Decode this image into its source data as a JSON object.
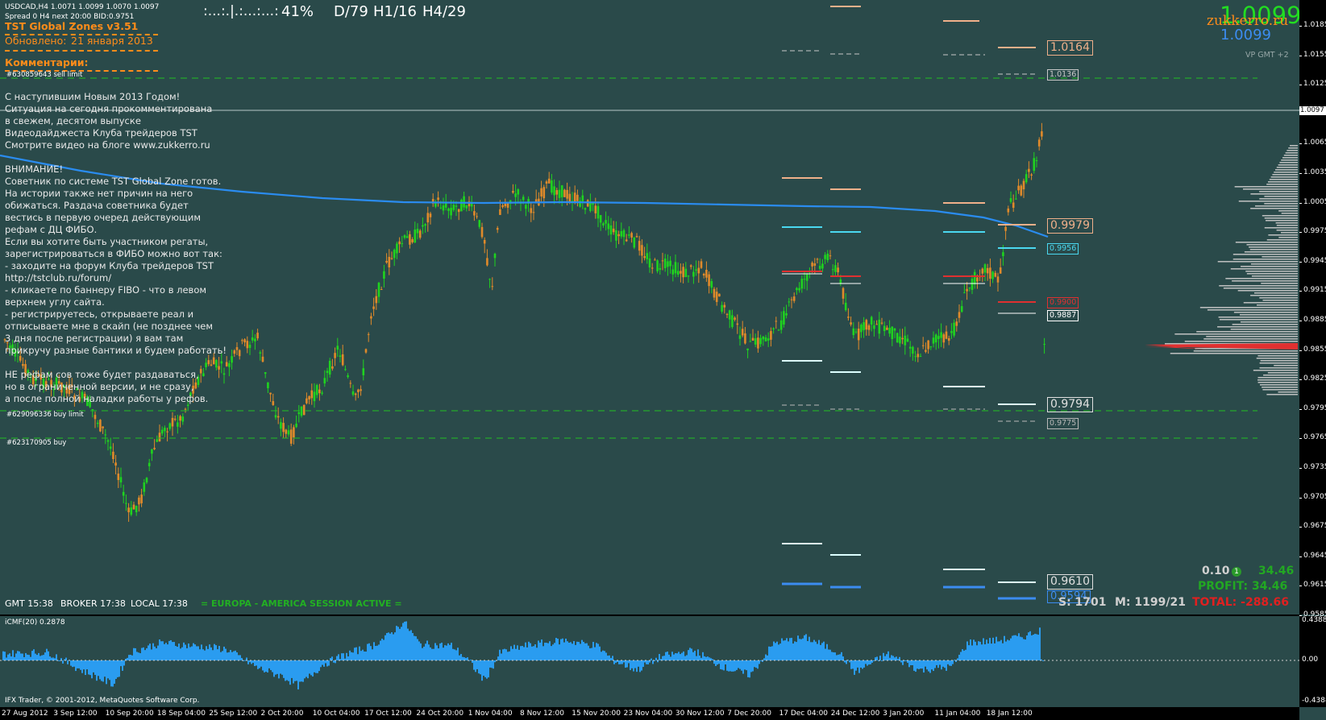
{
  "header": {
    "symbol_line": "USDCAD,H4  1.0071 1.0099 1.0070 1.0097",
    "spread_line": "Spread 0  H4 next 20:00 BID:0.9751",
    "progress_dots": ":...:.|.:...:...:",
    "progress_pct": "41%",
    "d_stat": "D/79",
    "h1_stat": "H1/16",
    "h4_stat": "H4/29"
  },
  "panel": {
    "title": "TST Global Zones  v3.51",
    "updated_label": "Обновлено:",
    "updated_date": "21 января 2013",
    "comments_title": "Комментарии:",
    "order_sell_limit": "#630859643 sell limit",
    "order_buy_limit": "#629096336 buy limit",
    "order_buy": "#623170905 buy",
    "comment_lines": [
      "С наступившим  Новым 2013 Годом!",
      "Ситуация на сегодня прокомментирована",
      " в свежем, десятом  выпуске",
      " Видеодайджеста Клуба трейдеров TST",
      "Смотрите видео на блоге www.zukkerro.ru",
      "",
      "ВНИМАНИЕ!",
      "Советник по системе TST Global Zone готов.",
      "На истории также нет причин на него",
      "обижаться. Раздача советника будет",
      "  вестись в первую очеред действующим",
      "  рефам с ДЦ ФИБО.",
      "Если вы хотите быть участником регаты,",
      "зарегистрироваться в ФИБО можно вот так:",
      "- заходите на форум Клуба трейдеров TST",
      "http://tstclub.ru/forum/",
      "- кликаете по баннеру FIBO  - что в левом",
      "верхнем углу сайта.",
      "- регистрируетесь, открываете реал и",
      "отписываете мне в скайп  (не позднее чем",
      "  3 дня после регистрации) я вам там",
      "  прикручу разные бантики и будем работать!",
      "",
      "НЕ рефам сов тоже будет раздаваться,",
      "но в ограниченной версии, и не сразу,",
      " а после полной наладки работы у рефов."
    ]
  },
  "top_right": {
    "big_price": "1.0099",
    "brand": "zukkerro.ru",
    "blue_price": "1.0099",
    "vp_label": "VP GMT +2"
  },
  "zones": {
    "z1": "1.0164",
    "z2": "1.0136",
    "z3": "0.9979",
    "z4": "0.9956",
    "z5": "0.9900",
    "z6": "0.9887",
    "z7": "0.9794",
    "z8": "0.9775",
    "z9": "0.9610",
    "z10": "0.9594"
  },
  "bottom": {
    "gmt": "GMT 15:38",
    "broker": "BROKER 17:38",
    "local": "LOCAL 17:38",
    "session": "= EUROPA - AMERICA SESSION ACTIVE =",
    "lot": "0.10",
    "lot_badge": "1",
    "lot_profit": "34.46",
    "profit_label": "PROFIT: 34.46",
    "s_stat": "S: 1701",
    "m_stat": "M: 1199/21",
    "total_label": "TOTAL: -288.66",
    "copyright": "IFX Trader, © 2001-2012, MetaQuotes Software Corp."
  },
  "indicator": {
    "title": "iCMF(20) 0.2878",
    "axis": [
      "0.4388",
      "0.00",
      "-0.4388"
    ]
  },
  "price_axis": {
    "labels": [
      "1.0185",
      "1.0155",
      "1.0125",
      "1.0095",
      "1.0065",
      "1.0035",
      "1.0005",
      "0.9975",
      "0.9945",
      "0.9915",
      "0.9885",
      "0.9855",
      "0.9825",
      "0.9795",
      "0.9765",
      "0.9735",
      "0.9705",
      "0.9675",
      "0.9645",
      "0.9615",
      "0.9585"
    ],
    "current": "1.0097"
  },
  "time_axis": {
    "labels": [
      "27 Aug 2012",
      "3 Sep 12:00",
      "10 Sep 20:00",
      "18 Sep 04:00",
      "25 Sep 12:00",
      "2 Oct 20:00",
      "10 Oct 04:00",
      "17 Oct 12:00",
      "24 Oct 20:00",
      "1 Nov 04:00",
      "8 Nov 12:00",
      "15 Nov 20:00",
      "23 Nov 04:00",
      "30 Nov 12:00",
      "7 Dec 20:00",
      "17 Dec 04:00",
      "24 Dec 12:00",
      "3 Jan 20:00",
      "11 Jan 04:00",
      "18 Jan 12:00"
    ]
  },
  "colors": {
    "background": "#2a4a4a",
    "bull": "#1fd31f",
    "bear": "#e08a2a",
    "ma": "#2a8cf0",
    "zone_orange": "#f0b08a",
    "zone_cyan": "#4ad8f0",
    "zone_red": "#e03030",
    "indicator": "#2a9cf0"
  }
}
